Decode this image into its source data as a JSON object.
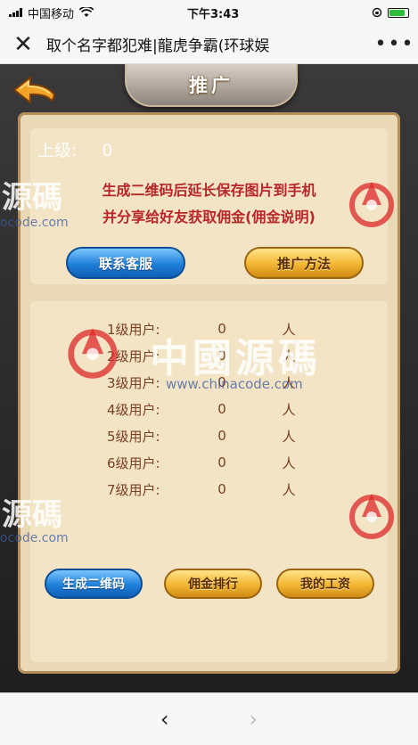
{
  "status": {
    "carrier": "中国移动",
    "time": "下午3:43",
    "battery_level": 0.85,
    "colors": {
      "battery": "#2dbe3b"
    }
  },
  "nav": {
    "close_icon": "close-icon",
    "title": "取个名字都犯难|龍虎争霸(环球娱",
    "more_icon": "more-icon"
  },
  "page": {
    "title": "推广",
    "back_icon": "back-arrow-icon",
    "superior_label": "上级:",
    "superior_value": "0",
    "notice_line1": "生成二维码后延长保存图片到手机",
    "notice_line2": "并分享给好友获取佣金(佣金说明)",
    "contact_button": "联系客服",
    "method_button": "推广方法",
    "levels": [
      {
        "label": "1级用户:",
        "count": "0",
        "unit": "人"
      },
      {
        "label": "2级用户:",
        "count": "0",
        "unit": "人"
      },
      {
        "label": "3级用户:",
        "count": "0",
        "unit": "人"
      },
      {
        "label": "4级用户:",
        "count": "0",
        "unit": "人"
      },
      {
        "label": "5级用户:",
        "count": "0",
        "unit": "人"
      },
      {
        "label": "6级用户:",
        "count": "0",
        "unit": "人"
      },
      {
        "label": "7级用户:",
        "count": "0",
        "unit": "人"
      }
    ],
    "generate_qr_button": "生成二维码",
    "commission_rank_button": "佣金排行",
    "my_salary_button": "我的工资",
    "colors": {
      "notice": "#b8262a",
      "row_text": "#7a3f22",
      "panel": "#e9d9b6"
    }
  },
  "watermarks": {
    "text_small": "源碼",
    "text_large": "中國源碼",
    "site": "www.chinacode.com",
    "site_short": "ocode.com"
  },
  "bottom": {
    "back_icon": "chevron-left-icon",
    "forward_icon": "chevron-right-icon"
  }
}
